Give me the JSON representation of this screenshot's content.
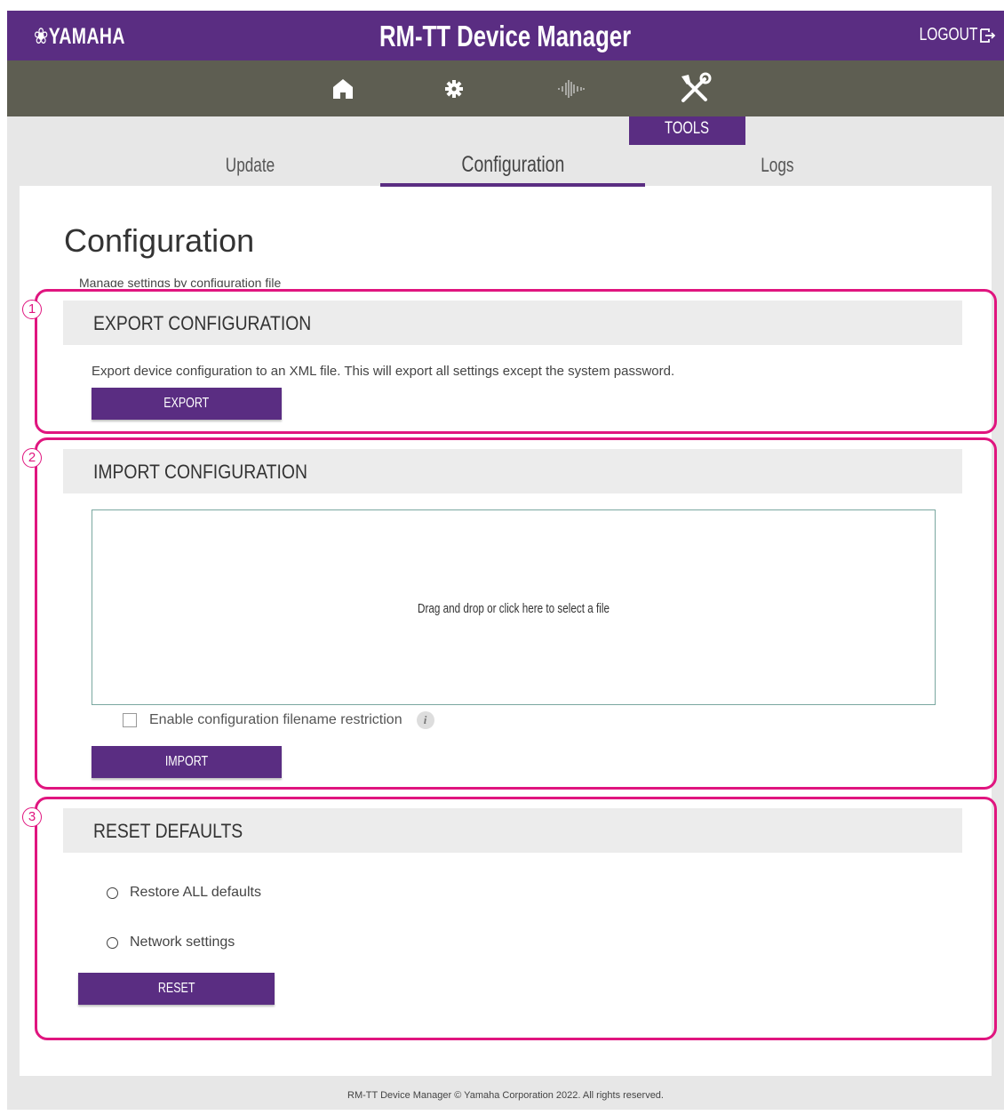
{
  "header": {
    "brand": "YAMAHA",
    "title": "RM-TT Device Manager",
    "logout_label": "LOGOUT"
  },
  "nav": {
    "icons": [
      "home-icon",
      "gear-icon",
      "audio-waveform-icon",
      "tools-icon"
    ],
    "active_label": "TOOLS"
  },
  "subnav": {
    "tabs": [
      "Update",
      "Configuration",
      "Logs"
    ],
    "active": "Configuration"
  },
  "page": {
    "title": "Configuration",
    "subtitle": "Manage settings by configuration file"
  },
  "export": {
    "number": "1",
    "title": "EXPORT CONFIGURATION",
    "description": "Export device configuration to an XML file. This will export all settings except the system password.",
    "button": "EXPORT"
  },
  "import": {
    "number": "2",
    "title": "IMPORT CONFIGURATION",
    "dropzone": "Drag and drop or click here to select a file",
    "checkbox_label": "Enable configuration filename restriction",
    "checkbox_checked": false,
    "info": "i",
    "button": "IMPORT"
  },
  "reset": {
    "number": "3",
    "title": "RESET DEFAULTS",
    "options": [
      "Restore ALL defaults",
      "Network settings"
    ],
    "button": "RESET"
  },
  "footer": {
    "text": "RM-TT Device Manager © Yamaha Corporation 2022. All rights reserved."
  },
  "colors": {
    "brand": "#5a2d82",
    "nav_bar": "#5e5e52",
    "annotation": "#e0157f",
    "panel": "#e7e7e7"
  }
}
